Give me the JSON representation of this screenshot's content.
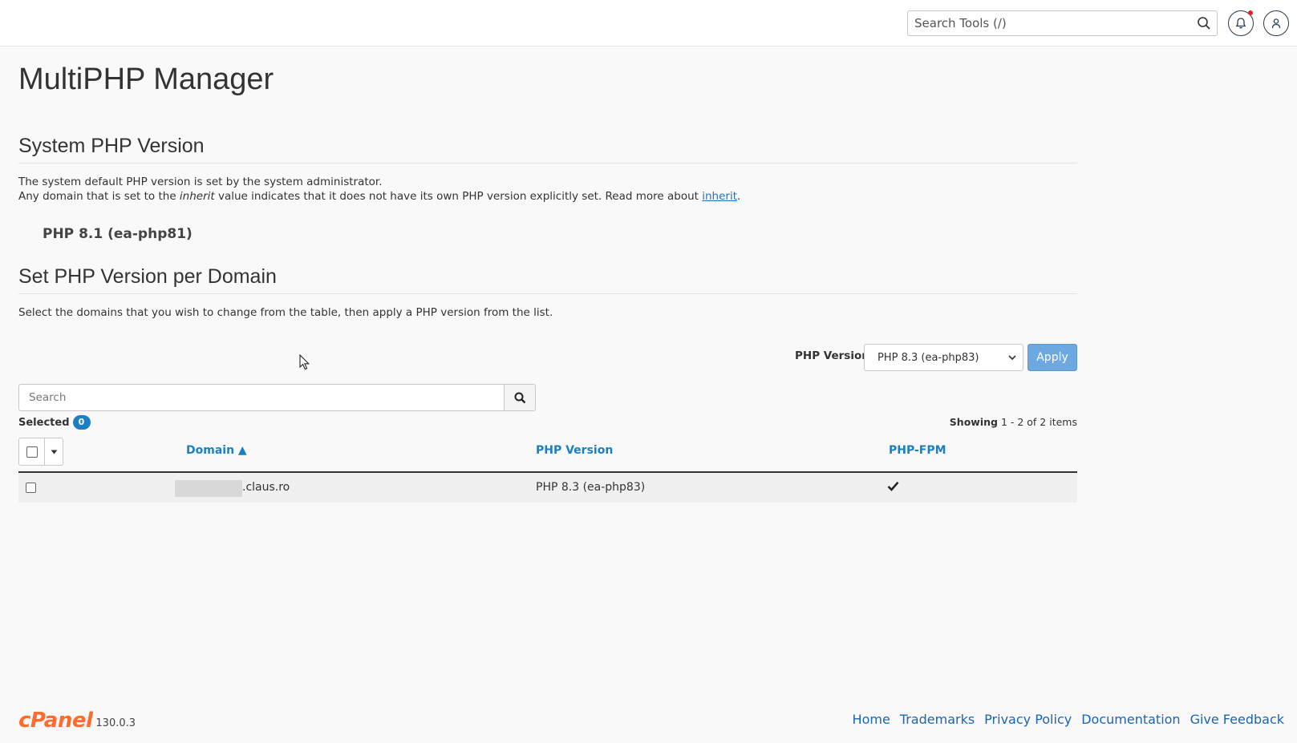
{
  "header": {
    "search_placeholder": "Search Tools (/)",
    "search_icon": "search-icon",
    "bell_icon": "bell-icon",
    "user_icon": "user-icon"
  },
  "page": {
    "title": "MultiPHP Manager"
  },
  "system": {
    "heading": "System PHP Version",
    "line1": "The system default PHP version is set by the system administrator.",
    "line2_prefix": "Any domain that is set to the ",
    "line2_em": "inherit",
    "line2_middle": " value indicates that it does not have its own PHP version explicitly set. Read more about ",
    "line2_link": "inherit",
    "line2_suffix": ".",
    "current_version": "PHP 8.1 (ea-php81)"
  },
  "per_domain": {
    "heading": "Set PHP Version per Domain",
    "instructions": "Select the domains that you wish to change from the table, then apply a PHP version from the list.",
    "php_version_label": "PHP Version",
    "php_version_selected": "PHP 8.3 (ea-php83)",
    "apply_label": "Apply",
    "search_placeholder": "Search",
    "selected_label": "Selected",
    "selected_count": "0",
    "showing_label": "Showing",
    "showing_range": "1 - 2 of 2 items"
  },
  "table": {
    "columns": {
      "domain": "Domain ▲",
      "php_version": "PHP Version",
      "php_fpm": "PHP-FPM"
    },
    "rows": [
      {
        "domain": ".claus.ro",
        "php_version": "PHP 8.3 (ea-php83)",
        "php_fpm": true
      }
    ]
  },
  "footer": {
    "logo_text": "cPanel",
    "version": "130.0.3",
    "links": [
      "Home",
      "Trademarks",
      "Privacy Policy",
      "Documentation",
      "Give Feedback"
    ]
  },
  "colors": {
    "accent": "#1b7fc4",
    "apply_button": "#6ea8e0",
    "brand": "#ff6c2c",
    "notification_dot": "#e0202a"
  }
}
